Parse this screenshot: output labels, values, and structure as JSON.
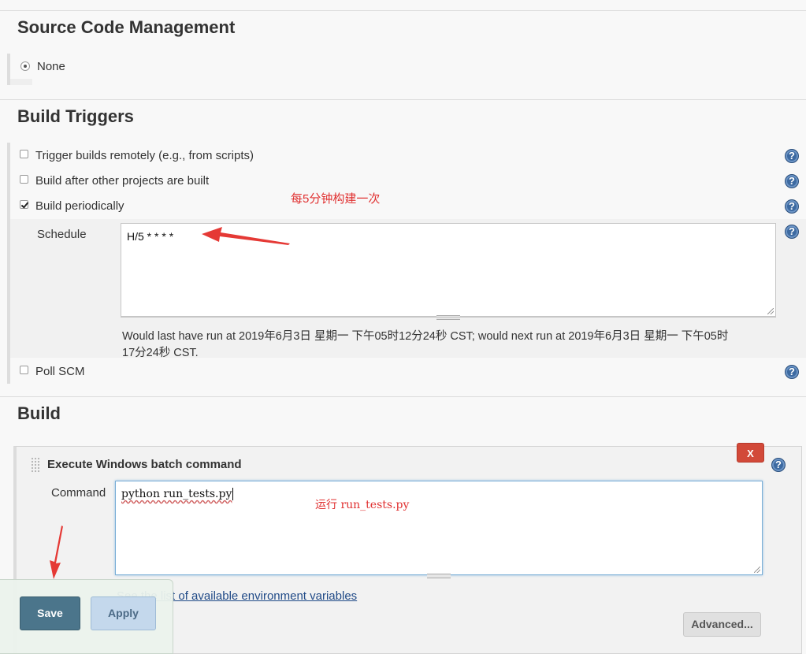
{
  "scm": {
    "title": "Source Code Management",
    "none_label": "None"
  },
  "triggers": {
    "title": "Build Triggers",
    "remote_label": "Trigger builds remotely (e.g., from scripts)",
    "after_label": "Build after other projects are built",
    "periodic_label": "Build periodically",
    "annotation": "每5分钟构建一次",
    "schedule_label": "Schedule",
    "schedule_value": "H/5 * * * *",
    "schedule_info_line1": "Would last have run at 2019年6月3日 星期一 下午05时12分24秒 CST; would next run at 2019年6月3日 星期一 下午05时",
    "schedule_info_line2": "17分24秒 CST.",
    "poll_label": "Poll SCM"
  },
  "build": {
    "title": "Build",
    "step_title": "Execute Windows batch command",
    "delete_label": "X",
    "command_label": "Command",
    "command_value": "python run_tests.py",
    "annotation": "运行 run_tests.py",
    "env_link": "See the list of available environment variables",
    "advanced_label": "Advanced..."
  },
  "footer": {
    "save_label": "Save",
    "apply_label": "Apply"
  },
  "colors": {
    "annotation": "#e03030",
    "save_bg": "#4b758b",
    "apply_bg": "#c4d8ec",
    "delete_bg": "#d24939",
    "help_bg": "#3d6aa1"
  },
  "icons": {
    "help": "question-circle-icon",
    "arrow": "red-arrow-icon",
    "drag": "drag-handle-icon"
  }
}
